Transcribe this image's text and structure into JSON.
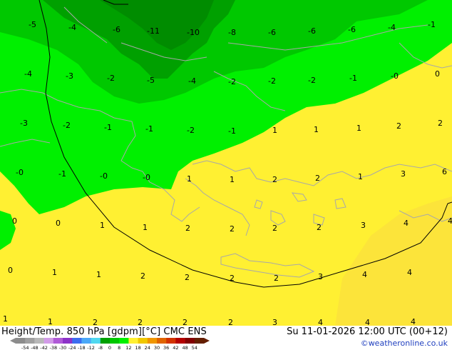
{
  "map_title": "Height/Temp. 850 hPa [gdpm][°C] CMC ENS",
  "valid_time": "Su 11-01-2026 12:00 UTC (00+12)",
  "credit": "©weatheronline.co.uk",
  "color_scale": {
    "ticks": [
      "-54",
      "-48",
      "-42",
      "-38",
      "-30",
      "-24",
      "-18",
      "-12",
      "-8",
      "0",
      "8",
      "12",
      "18",
      "24",
      "30",
      "36",
      "42",
      "48",
      "54"
    ],
    "colors": [
      "#8c8c8c",
      "#a0a0a0",
      "#b8b8b8",
      "#d29be8",
      "#b05ad8",
      "#8c32c8",
      "#3c6cf0",
      "#4aa8f8",
      "#50d8f0",
      "#00a000",
      "#00c800",
      "#00f000",
      "#fff032",
      "#f0c800",
      "#f09600",
      "#e06400",
      "#d23200",
      "#b40000",
      "#820000",
      "#641e00"
    ]
  },
  "labels": [
    {
      "t": "-5"
    },
    {
      "t": "-4"
    },
    {
      "t": "-6"
    },
    {
      "t": "-11"
    },
    {
      "t": "-10"
    },
    {
      "t": "-8"
    },
    {
      "t": "-6"
    },
    {
      "t": "-6"
    },
    {
      "t": "-6"
    },
    {
      "t": "-4"
    },
    {
      "t": "-1"
    },
    {
      "t": "-4"
    },
    {
      "t": "-3"
    },
    {
      "t": "-2"
    },
    {
      "t": "-5"
    },
    {
      "t": "-4"
    },
    {
      "t": "-2"
    },
    {
      "t": "-2"
    },
    {
      "t": "-2"
    },
    {
      "t": "-1"
    },
    {
      "t": "-0"
    },
    {
      "t": "0"
    },
    {
      "t": "-3"
    },
    {
      "t": "-2"
    },
    {
      "t": "-1"
    },
    {
      "t": "-1"
    },
    {
      "t": "-2"
    },
    {
      "t": "-1"
    },
    {
      "t": "1"
    },
    {
      "t": "1"
    },
    {
      "t": "1"
    },
    {
      "t": "2"
    },
    {
      "t": "2"
    },
    {
      "t": "-0"
    },
    {
      "t": "-1"
    },
    {
      "t": "-0"
    },
    {
      "t": "-0"
    },
    {
      "t": "1"
    },
    {
      "t": "1"
    },
    {
      "t": "2"
    },
    {
      "t": "2"
    },
    {
      "t": "1"
    },
    {
      "t": "3"
    },
    {
      "t": "6"
    },
    {
      "t": "0"
    },
    {
      "t": "0"
    },
    {
      "t": "1"
    },
    {
      "t": "1"
    },
    {
      "t": "2"
    },
    {
      "t": "2"
    },
    {
      "t": "2"
    },
    {
      "t": "2"
    },
    {
      "t": "3"
    },
    {
      "t": "4"
    },
    {
      "t": "4"
    },
    {
      "t": "0"
    },
    {
      "t": "1"
    },
    {
      "t": "1"
    },
    {
      "t": "2"
    },
    {
      "t": "2"
    },
    {
      "t": "2"
    },
    {
      "t": "2"
    },
    {
      "t": "3"
    },
    {
      "t": "4"
    },
    {
      "t": "4"
    },
    {
      "t": "1"
    },
    {
      "t": "1"
    },
    {
      "t": "2"
    },
    {
      "t": "2"
    },
    {
      "t": "2"
    },
    {
      "t": "2"
    },
    {
      "t": "3"
    },
    {
      "t": "4"
    },
    {
      "t": "4"
    },
    {
      "t": "4"
    }
  ]
}
